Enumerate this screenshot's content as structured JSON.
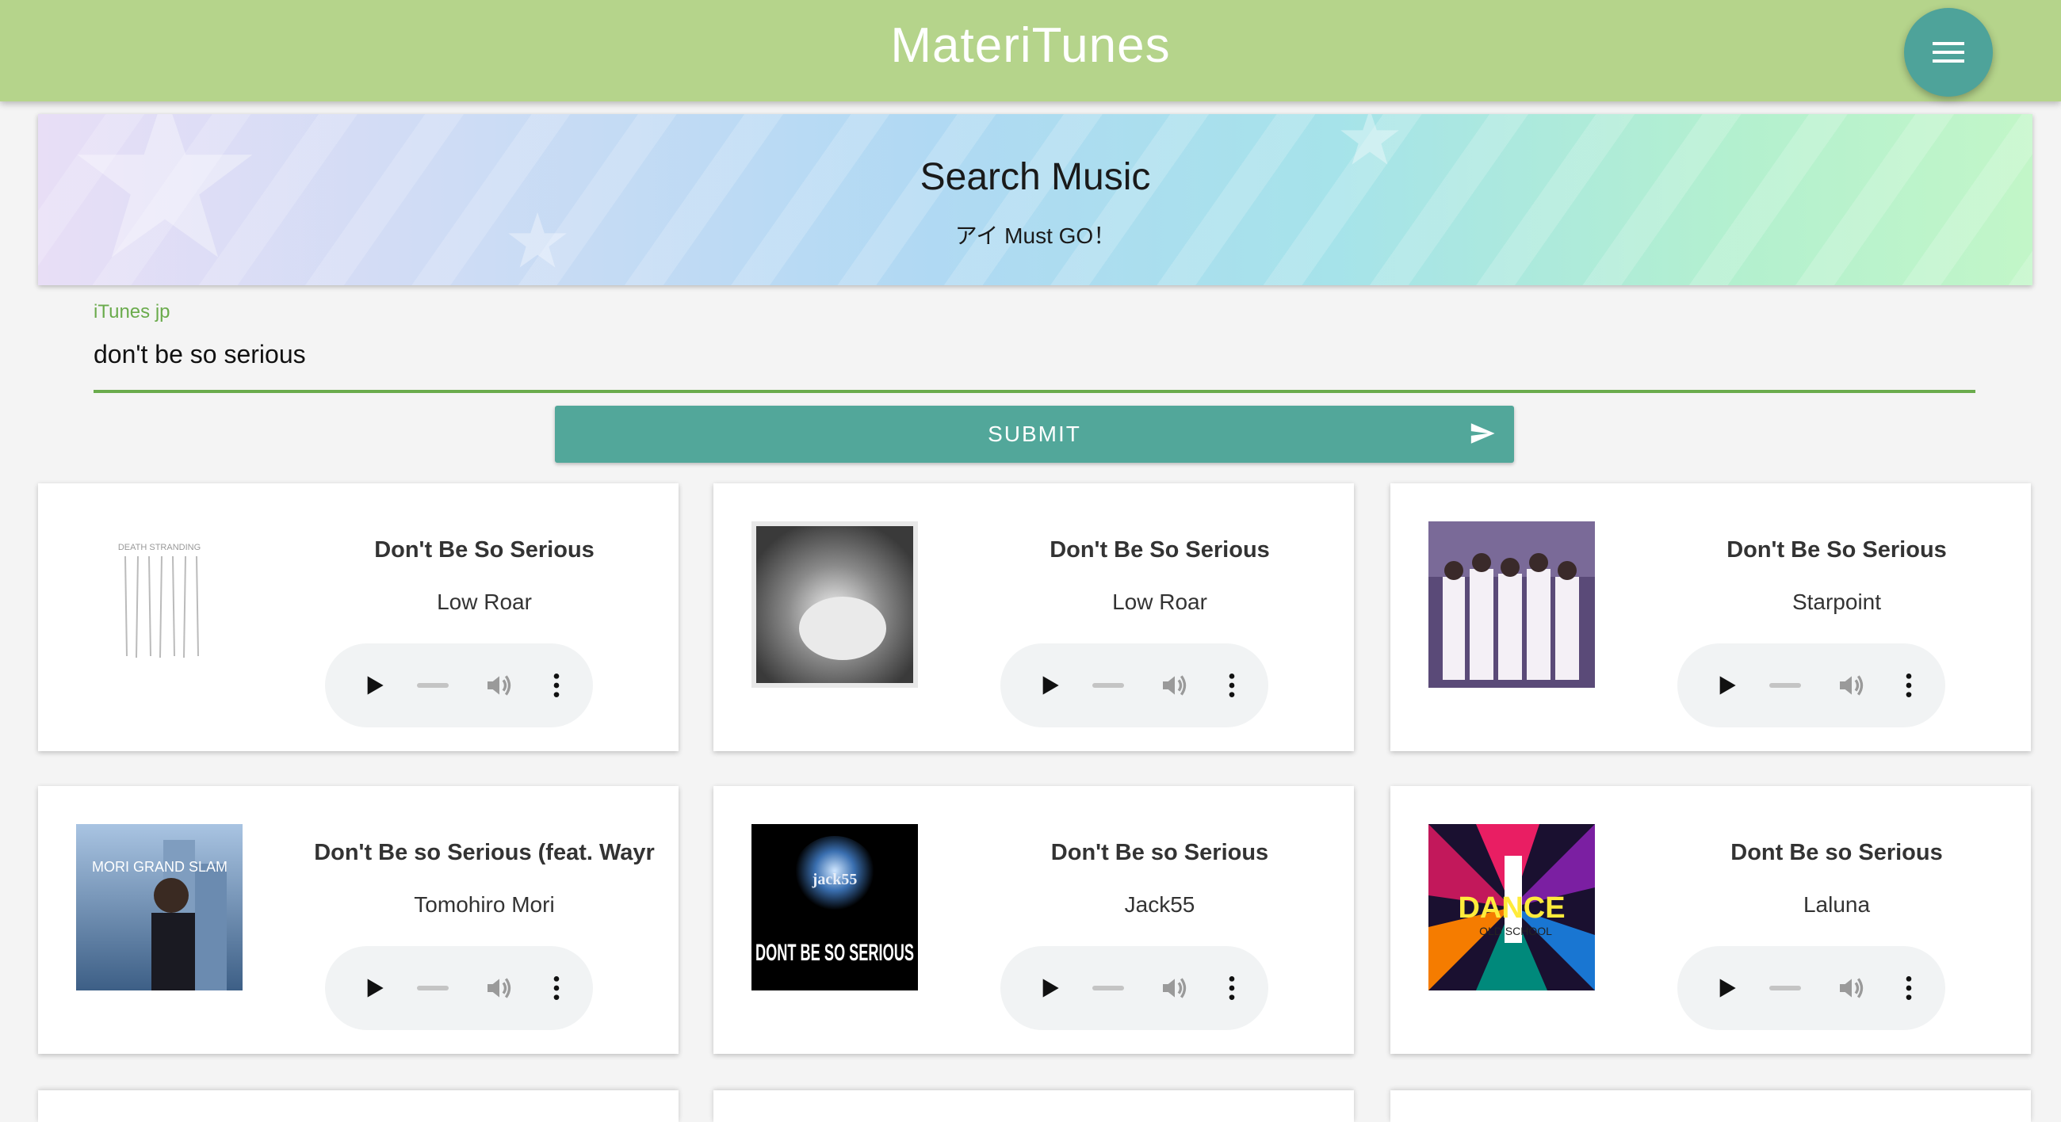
{
  "app": {
    "title": "MateriTunes",
    "menu_icon": "hamburger-menu-icon",
    "accent_color": "#b5d48b",
    "fab_color": "#4ea39a"
  },
  "banner": {
    "title": "Search Music",
    "subtitle": "アイ Must GO！"
  },
  "search": {
    "label": "iTunes jp",
    "value": "don't be so serious",
    "submit_label": "SUBMIT",
    "submit_icon": "send-icon"
  },
  "results": [
    {
      "title": "Don't Be So Serious",
      "artist": "Low Roar"
    },
    {
      "title": "Don't Be So Serious",
      "artist": "Low Roar"
    },
    {
      "title": "Don't Be So Serious",
      "artist": "Starpoint"
    },
    {
      "title": "Don't Be so Serious (feat. Wayr",
      "artist": "Tomohiro Mori"
    },
    {
      "title": "Don't Be so Serious",
      "artist": "Jack55"
    },
    {
      "title": "Dont Be so Serious",
      "artist": "Laluna"
    }
  ],
  "album_art_text": {
    "a1_top": "DEATH STRANDING",
    "a6": "DANCE",
    "a6_small": "OLD SCHOOL",
    "a4": "MORI GRAND SLAM",
    "a5_logo": "jack55",
    "a5_text": "DONT BE SO SERIOUS"
  }
}
